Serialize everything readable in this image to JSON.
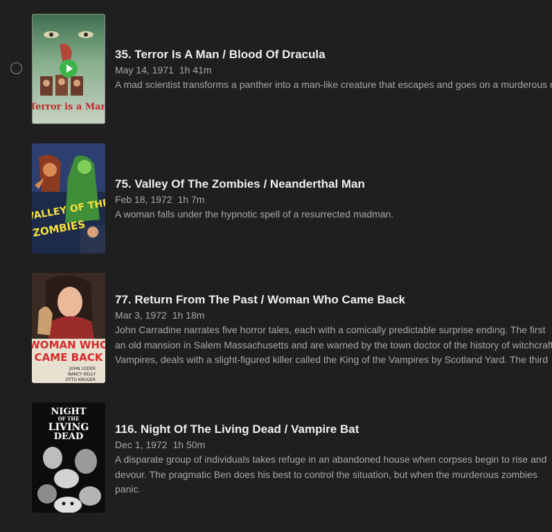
{
  "episodes": [
    {
      "title": "35. Terror Is A Man / Blood Of Dracula",
      "date": "May 14, 1971",
      "duration": "1h 41m",
      "description_lines": [
        "A mad scientist transforms a panther into a man-like creature that escapes and goes on a murderous rampage."
      ],
      "poster_text": "Terror is a Man",
      "selected": true
    },
    {
      "title": "75. Valley Of The Zombies / Neanderthal Man",
      "date": "Feb 18, 1972",
      "duration": "1h 7m",
      "description_lines": [
        "A woman falls under the hypnotic spell of a resurrected madman."
      ],
      "poster_text_1": "VALLEY OF THE",
      "poster_text_2": "ZOMBIES"
    },
    {
      "title": "77. Return From The Past / Woman Who Came Back",
      "date": "Mar 3, 1972",
      "duration": "1h 18m",
      "description_lines": [
        "John Carradine narrates five horror tales, each with a comically predictable surprise ending. The first",
        "an old mansion in Salem Massachusetts and are warned by the town doctor of the history of witchcraft",
        "Vampires, deals with a slight-figured killer called the King of the Vampires by Scotland Yard. The third"
      ],
      "poster_text_1": "WOMAN WHO",
      "poster_text_2": "CAME BACK",
      "poster_credits": [
        "JOHN LODER",
        "NANCY KELLY",
        "OTTO KRUGER"
      ]
    },
    {
      "title": "116. Night Of The Living Dead / Vampire Bat",
      "date": "Dec 1, 1972",
      "duration": "1h 50m",
      "description_lines": [
        "A disparate group of individuals takes refuge in an abandoned house when corpses begin to rise and",
        "devour. The pragmatic Ben does his best to control the situation, but when the murderous zombies",
        "panic."
      ],
      "poster_text_1": "NIGHT",
      "poster_text_2": "OF THE",
      "poster_text_3": "LIVING",
      "poster_text_4": "DEAD"
    }
  ],
  "colors": {
    "background": "#1f1f1f",
    "title": "#efefef",
    "meta": "#a8a8a8",
    "play_accent": "#3db449"
  }
}
